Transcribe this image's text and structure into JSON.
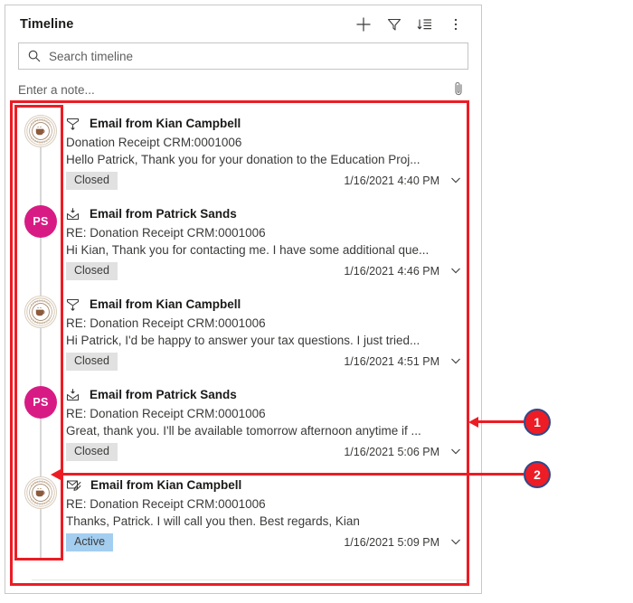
{
  "panel": {
    "title": "Timeline",
    "toolbar": [
      {
        "name": "add-icon",
        "label": "Add"
      },
      {
        "name": "filter-icon",
        "label": "Filter"
      },
      {
        "name": "sort-icon",
        "label": "Sort"
      },
      {
        "name": "more-icon",
        "label": "More commands"
      }
    ],
    "search": {
      "placeholder": "Search timeline",
      "value": "",
      "icon": "search-icon"
    },
    "note": {
      "placeholder": "Enter a note...",
      "value": "",
      "attach_icon": "paperclip-icon"
    }
  },
  "colors": {
    "annotation_red": "#ec1c24",
    "bubble_border": "#2b4a8b",
    "avatar_pink": "#d81b84",
    "badge_closed_bg": "#e1e1e1",
    "badge_active_bg": "#a3cef0",
    "rail_line": "#d8d8d8"
  },
  "timeline": {
    "items": [
      {
        "title": "Email from Kian Campbell",
        "subject": "Donation Receipt CRM:0001006",
        "preview": "Hello Patrick,   Thank you for your donation to the Education Proj...",
        "status": "Closed",
        "status_kind": "closed",
        "timestamp": "1/16/2021 4:40 PM",
        "icon": "email-sent-icon",
        "avatar_kind": "logo",
        "avatar_initials": "",
        "avatar_name": "org-logo-avatar"
      },
      {
        "title": "Email from Patrick Sands",
        "subject": "RE: Donation Receipt CRM:0001006",
        "preview": "Hi Kian, Thank you for contacting me. I have some additional que...",
        "status": "Closed",
        "status_kind": "closed",
        "timestamp": "1/16/2021 4:46 PM",
        "icon": "email-received-icon",
        "avatar_kind": "initials",
        "avatar_initials": "PS",
        "avatar_name": "patrick-sands-avatar"
      },
      {
        "title": "Email from Kian Campbell",
        "subject": "RE: Donation Receipt CRM:0001006",
        "preview": "Hi Patrick,   I'd be happy to answer your tax questions. I just tried...",
        "status": "Closed",
        "status_kind": "closed",
        "timestamp": "1/16/2021 4:51 PM",
        "icon": "email-sent-icon",
        "avatar_kind": "logo",
        "avatar_initials": "",
        "avatar_name": "org-logo-avatar"
      },
      {
        "title": "Email from Patrick Sands",
        "subject": "RE: Donation Receipt CRM:0001006",
        "preview": "Great, thank you. I'll be available tomorrow afternoon anytime if ...",
        "status": "Closed",
        "status_kind": "closed",
        "timestamp": "1/16/2021 5:06 PM",
        "icon": "email-received-icon",
        "avatar_kind": "initials",
        "avatar_initials": "PS",
        "avatar_name": "patrick-sands-avatar"
      },
      {
        "title": "Email from Kian Campbell",
        "subject": "RE: Donation Receipt CRM:0001006",
        "preview": "Thanks, Patrick. I will call you then.   Best regards, Kian",
        "status": "Active",
        "status_kind": "active",
        "timestamp": "1/16/2021 5:09 PM",
        "icon": "email-draft-icon",
        "avatar_kind": "logo",
        "avatar_initials": "",
        "avatar_name": "org-logo-avatar"
      }
    ]
  },
  "annotations": [
    {
      "number": "1"
    },
    {
      "number": "2"
    }
  ]
}
